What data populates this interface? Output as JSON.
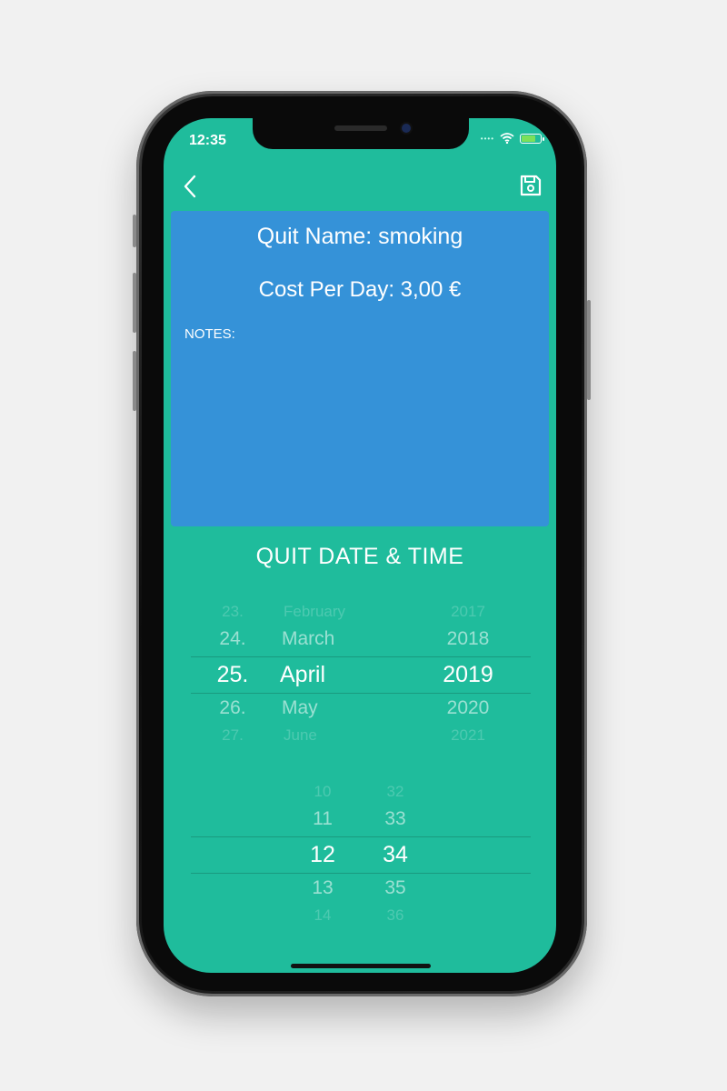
{
  "status_bar": {
    "time": "12:35",
    "icons": [
      "signal-dots",
      "wifi-icon",
      "battery-icon"
    ]
  },
  "nav": {
    "back_icon": "chevron-left-icon",
    "save_icon": "floppy-disk-icon"
  },
  "info_card": {
    "quit_name": "Quit Name: smoking",
    "cost_per_day": "Cost Per Day: 3,00 €",
    "notes_label": "NOTES:"
  },
  "section_title": "QUIT DATE & TIME",
  "date_picker": {
    "day": [
      "23.",
      "24.",
      "25.",
      "26.",
      "27."
    ],
    "month": [
      "February",
      "March",
      "April",
      "May",
      "June"
    ],
    "year": [
      "2017",
      "2018",
      "2019",
      "2020",
      "2021"
    ],
    "selected": {
      "day": "25.",
      "month": "April",
      "year": "2019"
    }
  },
  "time_picker": {
    "hour": [
      "10",
      "11",
      "12",
      "13",
      "14"
    ],
    "minute": [
      "32",
      "33",
      "34",
      "35",
      "36"
    ],
    "selected": {
      "hour": "12",
      "minute": "34"
    }
  },
  "colors": {
    "screen_bg": "#1fbc9c",
    "card_bg": "#3592d8",
    "text": "#ffffff"
  }
}
